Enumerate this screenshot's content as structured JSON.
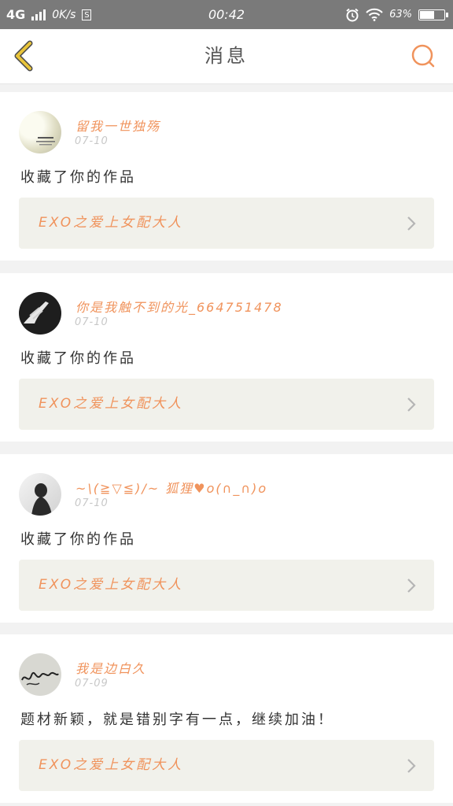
{
  "status_bar": {
    "network": "4G",
    "speed": "0K/s",
    "time": "00:42",
    "battery": "63%",
    "battery_level": 0.63,
    "icons": [
      "signal-icon",
      "sim-icon",
      "alarm-icon",
      "wifi-icon",
      "battery-icon"
    ]
  },
  "header": {
    "title": "消息",
    "back_icon": "back-chevron-icon",
    "search_icon": "search-icon"
  },
  "colors": {
    "accent": "#f0935c",
    "back_icon": "#e8c43a",
    "card_bg": "#ffffff",
    "work_bg": "#f1f1eb",
    "page_bg": "#f2f2f2"
  },
  "messages": [
    {
      "user": "留我一世独殇",
      "date": "07-10",
      "text": "收藏了你的作品",
      "work": "EXO之爱上女配大人"
    },
    {
      "user": "你是我触不到的光_664751478",
      "date": "07-10",
      "text": "收藏了你的作品",
      "work": "EXO之爱上女配大人"
    },
    {
      "user": "~\\(≧▽≦)/~ 狐狸♥o(∩_∩)o",
      "date": "07-10",
      "text": "收藏了你的作品",
      "work": "EXO之爱上女配大人"
    },
    {
      "user": "我是边白久",
      "date": "07-09",
      "text": "题材新颖，就是错别字有一点，继续加油！",
      "work": "EXO之爱上女配大人"
    }
  ]
}
